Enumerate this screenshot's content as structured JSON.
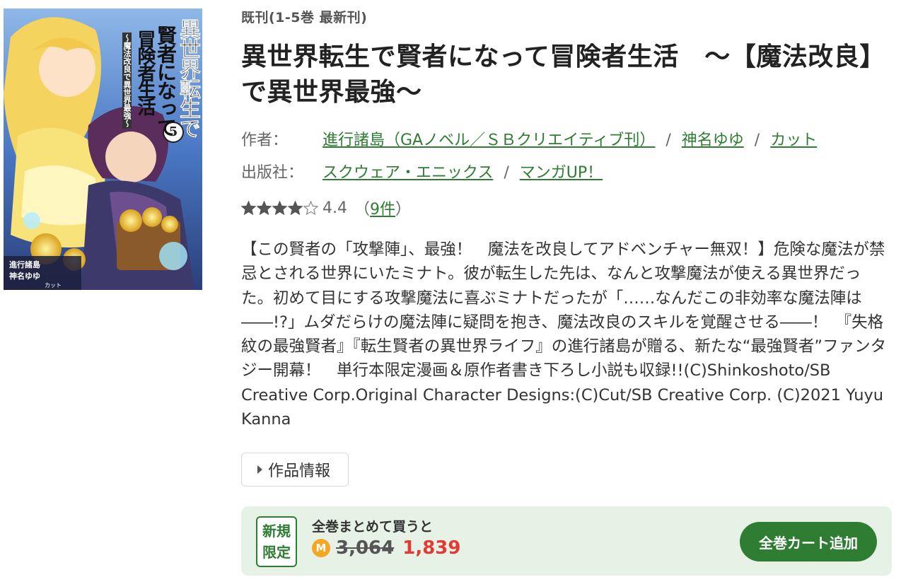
{
  "cover": {
    "title_col1": "異世界転生で",
    "title_col2": "賢者になって",
    "title_col3": "冒険者生活",
    "subtitle": "〜魔法改良で異世界最強〜",
    "volume": "5",
    "credit_author": "進行諸島",
    "credit_artist": "神名ゆゆ",
    "credit_chara": "カット"
  },
  "status": "既刊(1-5巻 最新刊)",
  "title": "異世界転生で賢者になって冒険者生活　～【魔法改良】で異世界最強～",
  "authors": {
    "label": "作者：",
    "items": [
      "進行諸島（GAノベル／ＳＢクリエイティブ刊）",
      "神名ゆゆ",
      "カット"
    ],
    "separator": "/"
  },
  "publishers": {
    "label": "出版社：",
    "items": [
      "スクウェア・エニックス",
      "マンガUP！"
    ],
    "separator": "/"
  },
  "rating": {
    "stars_filled": 4,
    "stars_total": 5,
    "score": "4.4",
    "paren_open": "（",
    "count": "9件",
    "paren_close": "）"
  },
  "description": "【この賢者の「攻撃陣」、最強！　魔法を改良してアドベンチャー無双！】危険な魔法が禁忌とされる世界にいたミナト。彼が転生した先は、なんと攻撃魔法が使える異世界だった。初めて目にする攻撃魔法に喜ぶミナトだったが「……なんだこの非効率な魔法陣は――!?」ムダだらけの魔法陣に疑問を抱き、魔法改良のスキルを覚醒させる――！　『失格紋の最強賢者』『転生賢者の異世界ライフ』の進行諸島が贈る、新たな“最強賢者”ファンタジー開幕！　単行本限定漫画＆原作者書き下ろし小説も収録!!(C)Shinkoshoto/SB Creative Corp.Original Character Designs:(C)Cut/SB Creative Corp. (C)2021 Yuyu Kanna",
  "work_info_label": "作品情報",
  "buy": {
    "badge_line1": "新規",
    "badge_line2": "限定",
    "bulk_label": "全巻まとめて買うと",
    "coin_icon": "M",
    "price_old": "3,064",
    "price_new": "1,839",
    "cart_button": "全巻カート追加"
  },
  "colors": {
    "link_green": "#2e7d32",
    "sale_red": "#e53935",
    "panel_bg": "#e6f2e6",
    "coin": "#f5a623"
  }
}
